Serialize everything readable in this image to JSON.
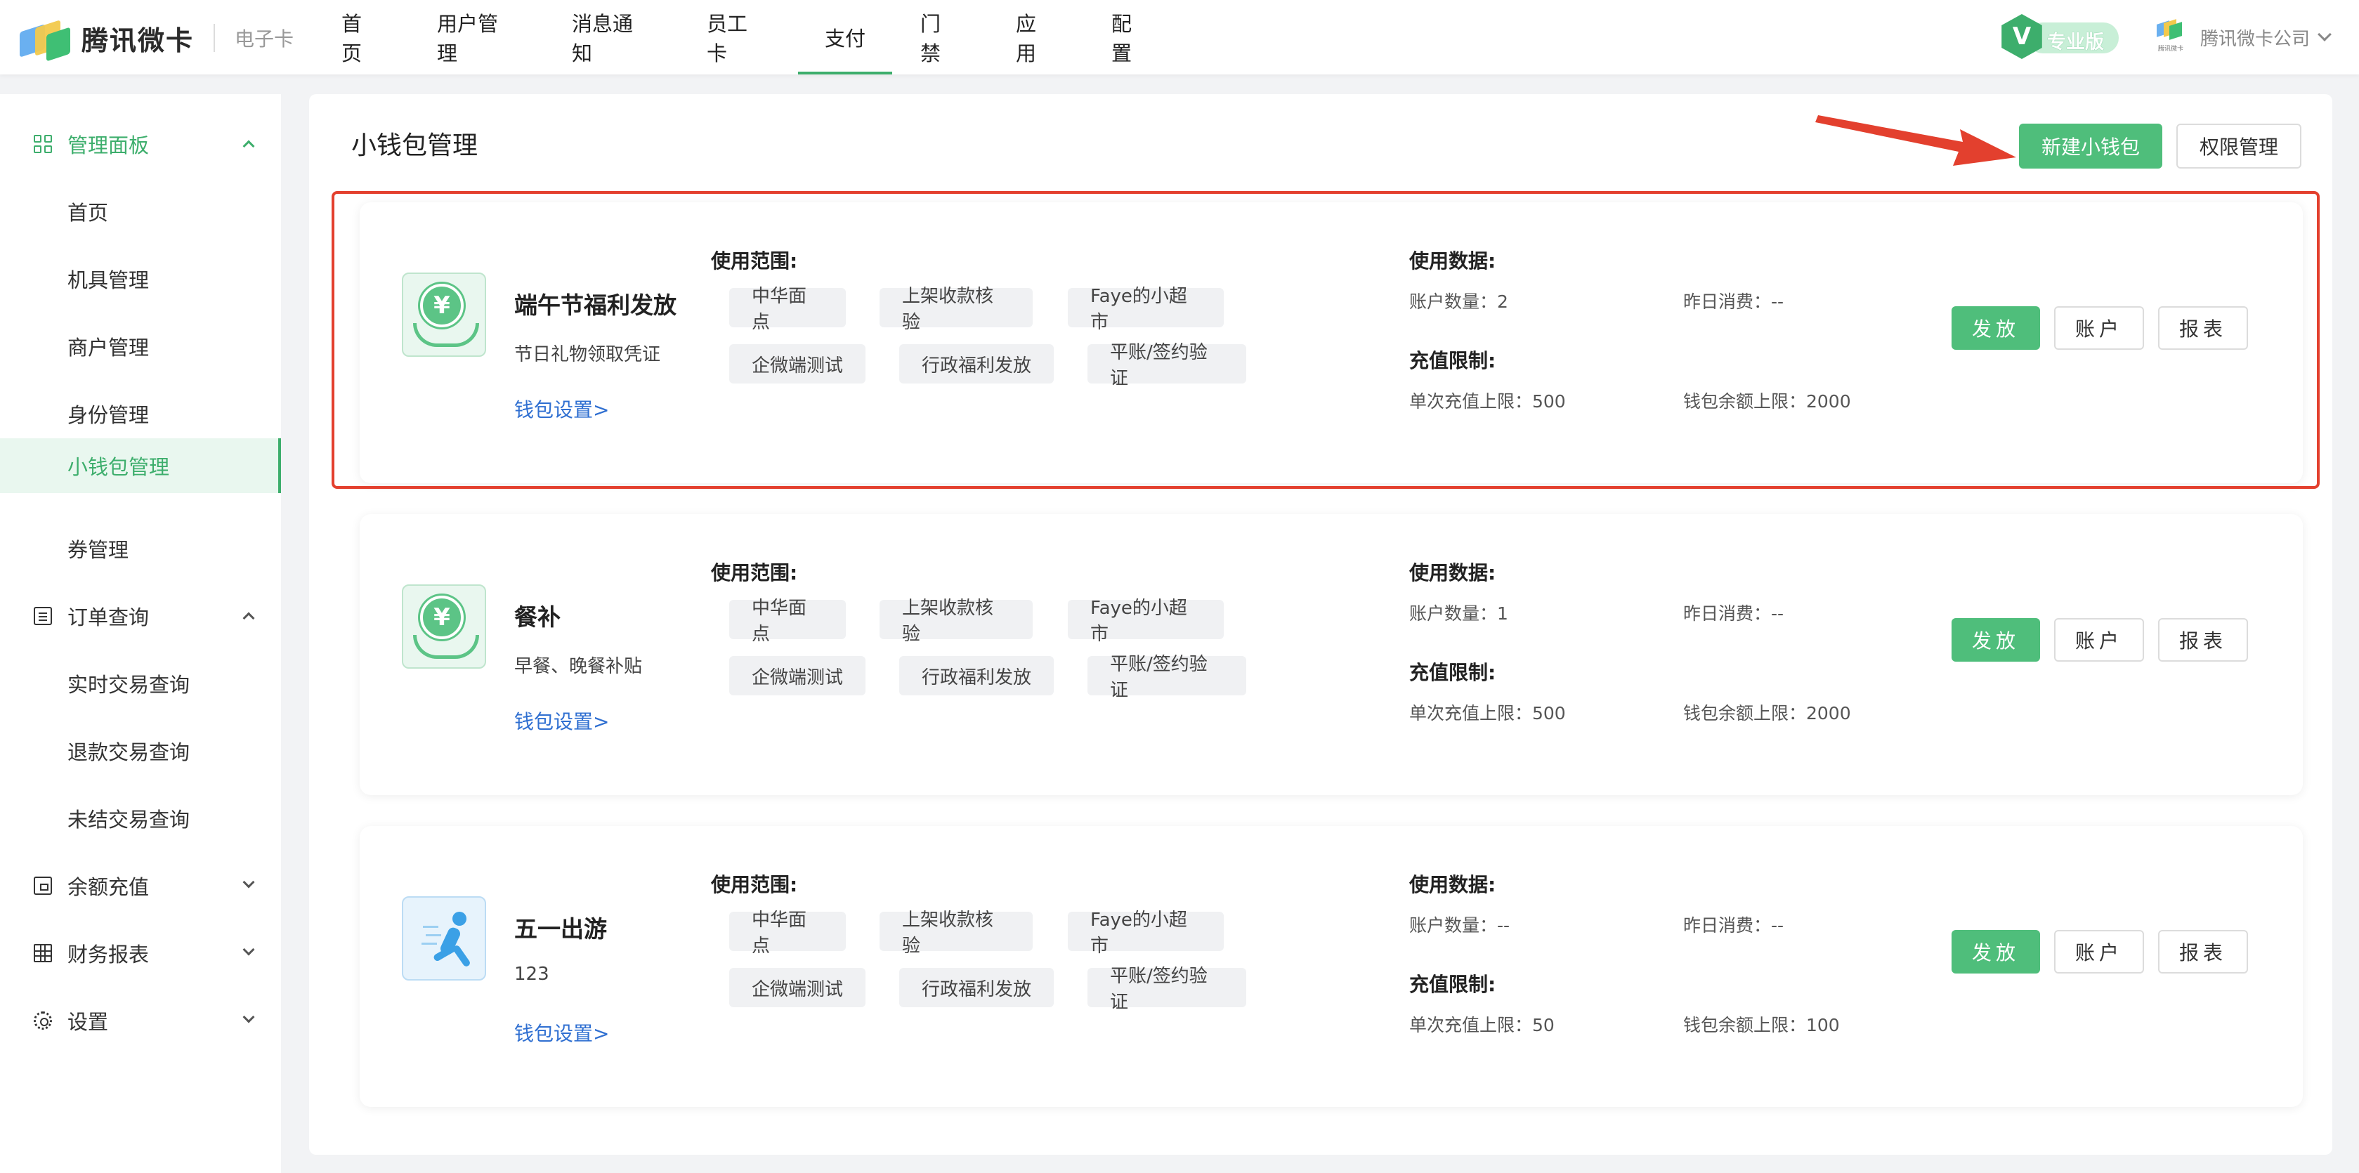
{
  "brand": {
    "name": "腾讯微卡",
    "sub": "电子卡"
  },
  "nav": [
    {
      "label": "首页"
    },
    {
      "label": "用户管理"
    },
    {
      "label": "消息通知"
    },
    {
      "label": "员工卡"
    },
    {
      "label": "支付",
      "active": true
    },
    {
      "label": "门禁"
    },
    {
      "label": "应用"
    },
    {
      "label": "配置"
    }
  ],
  "header": {
    "badge_glyph": "V",
    "badge_label": "专业版",
    "company_logo_caption": "腾讯微卡",
    "company": "腾讯微卡公司"
  },
  "sidebar": {
    "items": [
      {
        "label": "管理面板",
        "type": "group",
        "icon": "grid-icon",
        "expanded": true
      },
      {
        "label": "首页",
        "type": "sub"
      },
      {
        "label": "机具管理",
        "type": "sub"
      },
      {
        "label": "商户管理",
        "type": "sub"
      },
      {
        "label": "身份管理",
        "type": "sub"
      },
      {
        "label": "小钱包管理",
        "type": "sub",
        "active": true
      },
      {
        "label": "券管理",
        "type": "sub"
      },
      {
        "label": "订单查询",
        "type": "group",
        "icon": "list-icon",
        "expanded": true
      },
      {
        "label": "实时交易查询",
        "type": "sub"
      },
      {
        "label": "退款交易查询",
        "type": "sub"
      },
      {
        "label": "未结交易查询",
        "type": "sub"
      },
      {
        "label": "余额充值",
        "type": "group",
        "icon": "wallet-icon",
        "expanded": false
      },
      {
        "label": "财务报表",
        "type": "group",
        "icon": "table-icon",
        "expanded": false
      },
      {
        "label": "设置",
        "type": "group",
        "icon": "gear-icon",
        "expanded": false
      }
    ]
  },
  "main": {
    "title": "小钱包管理",
    "new_wallet_button": "新建小钱包",
    "permission_button": "权限管理"
  },
  "labels": {
    "scope": "使用范围:",
    "usage": "使用数据:",
    "limit": "充值限制:",
    "wallet_settings": "钱包设置>",
    "issue": "发放",
    "account": "账户",
    "report": "报表"
  },
  "wallets": [
    {
      "name": "端午节福利发放",
      "desc": "节日礼物领取凭证",
      "icon": "coin-hand-icon",
      "scope": [
        "中华面点",
        "上架收款核验",
        "Faye的小超市",
        "企微端测试",
        "行政福利发放",
        "平账/签约验证"
      ],
      "accounts": "账户数量：2",
      "yesterday": "昨日消费：--",
      "single_limit": "单次充值上限：500",
      "balance_limit": "钱包余额上限：2000"
    },
    {
      "name": "餐补",
      "desc": "早餐、晚餐补贴",
      "icon": "coin-hand-icon",
      "scope": [
        "中华面点",
        "上架收款核验",
        "Faye的小超市",
        "企微端测试",
        "行政福利发放",
        "平账/签约验证"
      ],
      "accounts": "账户数量：1",
      "yesterday": "昨日消费：--",
      "single_limit": "单次充值上限：500",
      "balance_limit": "钱包余额上限：2000"
    },
    {
      "name": "五一出游",
      "desc": "123",
      "icon": "runner-icon",
      "scope": [
        "中华面点",
        "上架收款核验",
        "Faye的小超市",
        "企微端测试",
        "行政福利发放",
        "平账/签约验证"
      ],
      "accounts": "账户数量：--",
      "yesterday": "昨日消费：--",
      "single_limit": "单次充值上限：50",
      "balance_limit": "钱包余额上限：100"
    }
  ],
  "colors": {
    "brand_green": "#3dae6c",
    "button_green": "#4fbe7b",
    "highlight_red": "#e3402e",
    "link_blue": "#2f6fd1"
  }
}
